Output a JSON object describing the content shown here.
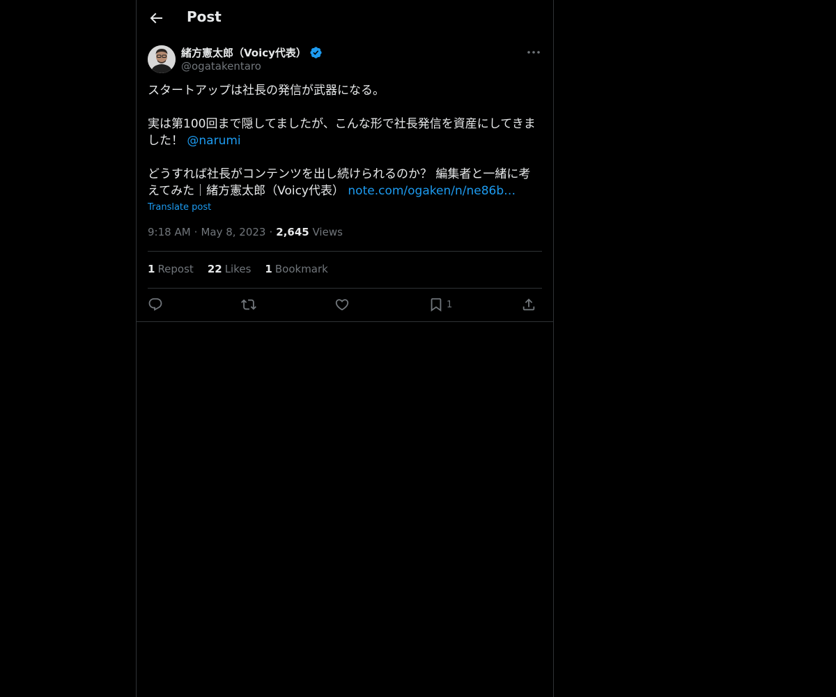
{
  "header": {
    "title": "Post"
  },
  "author": {
    "name": "緒方憲太郎（Voicy代表）",
    "handle": "@ogatakentaro"
  },
  "post": {
    "line1": "スタートアップは社長の発信が武器になる。",
    "line2": "実は第100回まで隠してましたが、こんな形で社長発信を資産にしてきました！",
    "mention": "@narumi",
    "line3": "どうすれば社長がコンテンツを出し続けられるのか？ 編集者と一緒に考えてみた｜緒方憲太郎（Voicy代表）",
    "link": "note.com/ogaken/n/ne86b…",
    "translate_label": "Translate post"
  },
  "meta": {
    "time": "9:18 AM",
    "date": "May 8, 2023",
    "views_count": "2,645",
    "views_label": "Views"
  },
  "stats": {
    "reposts_count": "1",
    "reposts_label": "Repost",
    "likes_count": "22",
    "likes_label": "Likes",
    "bookmarks_count": "1",
    "bookmarks_label": "Bookmark"
  },
  "actions": {
    "bookmark_count": "1"
  },
  "colors": {
    "background": "#000000",
    "text": "#e7e9ea",
    "secondary": "#71767b",
    "accent": "#1d9bf0",
    "border": "#2f3336"
  },
  "icons": [
    "back-arrow-icon",
    "verified-badge-icon",
    "more-icon",
    "reply-icon",
    "repost-icon",
    "like-icon",
    "bookmark-icon",
    "share-icon"
  ]
}
